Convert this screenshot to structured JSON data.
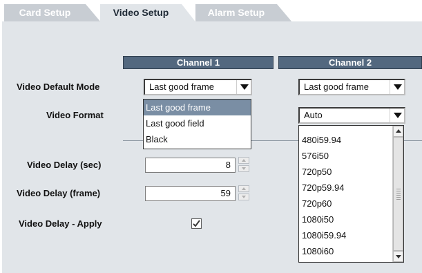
{
  "tabs": [
    {
      "label": "Card Setup",
      "active": false
    },
    {
      "label": "Video Setup",
      "active": true
    },
    {
      "label": "Alarm Setup",
      "active": false
    }
  ],
  "channels": {
    "ch1": "Channel 1",
    "ch2": "Channel 2"
  },
  "labels": {
    "default_mode": "Video Default Mode",
    "video_format": "Video Format",
    "delay_sec": "Video Delay (sec)",
    "delay_frame": "Video Delay (frame)",
    "delay_apply": "Video Delay - Apply"
  },
  "ch1": {
    "default_mode_value": "Last good frame",
    "default_mode_options": [
      "Last good frame",
      "Last good field",
      "Black"
    ],
    "default_mode_highlighted": "Last good frame",
    "delay_sec": "8",
    "delay_frame": "59",
    "delay_apply_checked": true,
    "checkmark": "☑"
  },
  "ch2": {
    "default_mode_value": "Last good frame",
    "video_format_value": "Auto",
    "video_format_options": [
      "480i59.94",
      "576i50",
      "720p50",
      "720p59.94",
      "720p60",
      "1080i50",
      "1080i59.94",
      "1080i60"
    ]
  },
  "colors": {
    "panel_bg": "#e1e5e9",
    "header_bg": "#53687f",
    "highlight": "#7a8ea4"
  }
}
